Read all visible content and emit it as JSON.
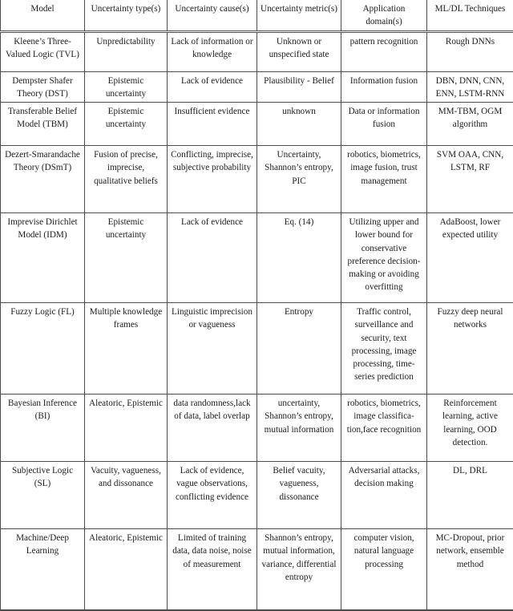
{
  "table": {
    "caption": "",
    "columns": [
      "Model",
      "Uncertainty type(s)",
      "Uncertainty cause(s)",
      "Uncertainty metric(s)",
      "Application domain(s)",
      "ML/DL Techniques"
    ],
    "rows": [
      {
        "model": "Kleene’s Three-Valued Logic (TVL)",
        "uncertainty_types": "Unpredictability",
        "uncertainty_causes": "Lack of information or knowledge",
        "uncertainty_metrics": "Unknown or unspecified state",
        "application_domains": "pattern recognition",
        "ml_dl_techniques": "Rough DNNs"
      },
      {
        "model": "Dempster Shafer Theory (DST)",
        "uncertainty_types": "Epistemic uncertainty",
        "uncertainty_causes": "Lack of evidence",
        "uncertainty_metrics": "Plausibility - Belief",
        "application_domains": "Information fusion",
        "ml_dl_techniques": "DBN, DNN, CNN, ENN, LSTM-RNN"
      },
      {
        "model": "Transferable Belief Model (TBM)",
        "uncertainty_types": "Epistemic uncertainty",
        "uncertainty_causes": "Insufficient evidence",
        "uncertainty_metrics": "unknown",
        "application_domains": "Data or information fusion",
        "ml_dl_techniques": "MM-TBM, OGM algorithm"
      },
      {
        "model": "Dezert-Smarandache Theory (DSmT)",
        "uncertainty_types": "Fusion of precise, imprecise, qualitative beliefs",
        "uncertainty_causes": "Conflicting, imprecise, subjective probability",
        "uncertainty_metrics": "Uncertainty, Shannon’s entropy, PIC",
        "application_domains": "robotics, biometrics, image fusion, trust management",
        "ml_dl_techniques": "SVM OAA, CNN, LSTM, RF"
      },
      {
        "model": "Imprevise Dirichlet Model (IDM)",
        "uncertainty_types": "Epistemic uncertainty",
        "uncertainty_causes": "Lack of evidence",
        "uncertainty_metrics": "Eq. (14)",
        "application_domains": "Utilizing upper and lower bound for conservative preference decision-making or avoiding overfitting",
        "ml_dl_techniques": "AdaBoost, lower expected utility"
      },
      {
        "model": "Fuzzy Logic (FL)",
        "uncertainty_types": "Multiple knowledge frames",
        "uncertainty_causes": "Linguistic imprecision or vagueness",
        "uncertainty_metrics": "Entropy",
        "application_domains": "Traffic control, surveillance and security, text processing, image processing, time-series prediction",
        "ml_dl_techniques": "Fuzzy deep neural networks"
      },
      {
        "model": "Bayesian Inference (BI)",
        "uncertainty_types": "Aleatoric, Epistemic",
        "uncertainty_causes": "data randomness,lack of data, label overlap",
        "uncertainty_metrics": "uncertainty, Shannon’s entropy, mutual information",
        "application_domains": "robotics, biometrics, image classifica-tion,face recognition",
        "ml_dl_techniques": "Reinforcement learning, active learning, OOD detection."
      },
      {
        "model": "Subjective Logic (SL)",
        "uncertainty_types": "Vacuity, vagueness, and dissonance",
        "uncertainty_causes": "Lack of evidence, vague observations, conflicting evidence",
        "uncertainty_metrics": "Belief vacuity, vagueness, dissonance",
        "application_domains": "Adversarial attacks, decision making",
        "ml_dl_techniques": "DL, DRL"
      },
      {
        "model": "Machine/Deep Learning",
        "uncertainty_types": "Aleatoric, Epistemic",
        "uncertainty_causes": "Limited of training data, data noise, noise of measurement",
        "uncertainty_metrics": "Shannon’s entropy, mutual information, variance, differential entropy",
        "application_domains": "computer vision, natural language processing",
        "ml_dl_techniques": "MC-Dropout, prior network, ensemble method"
      }
    ]
  }
}
